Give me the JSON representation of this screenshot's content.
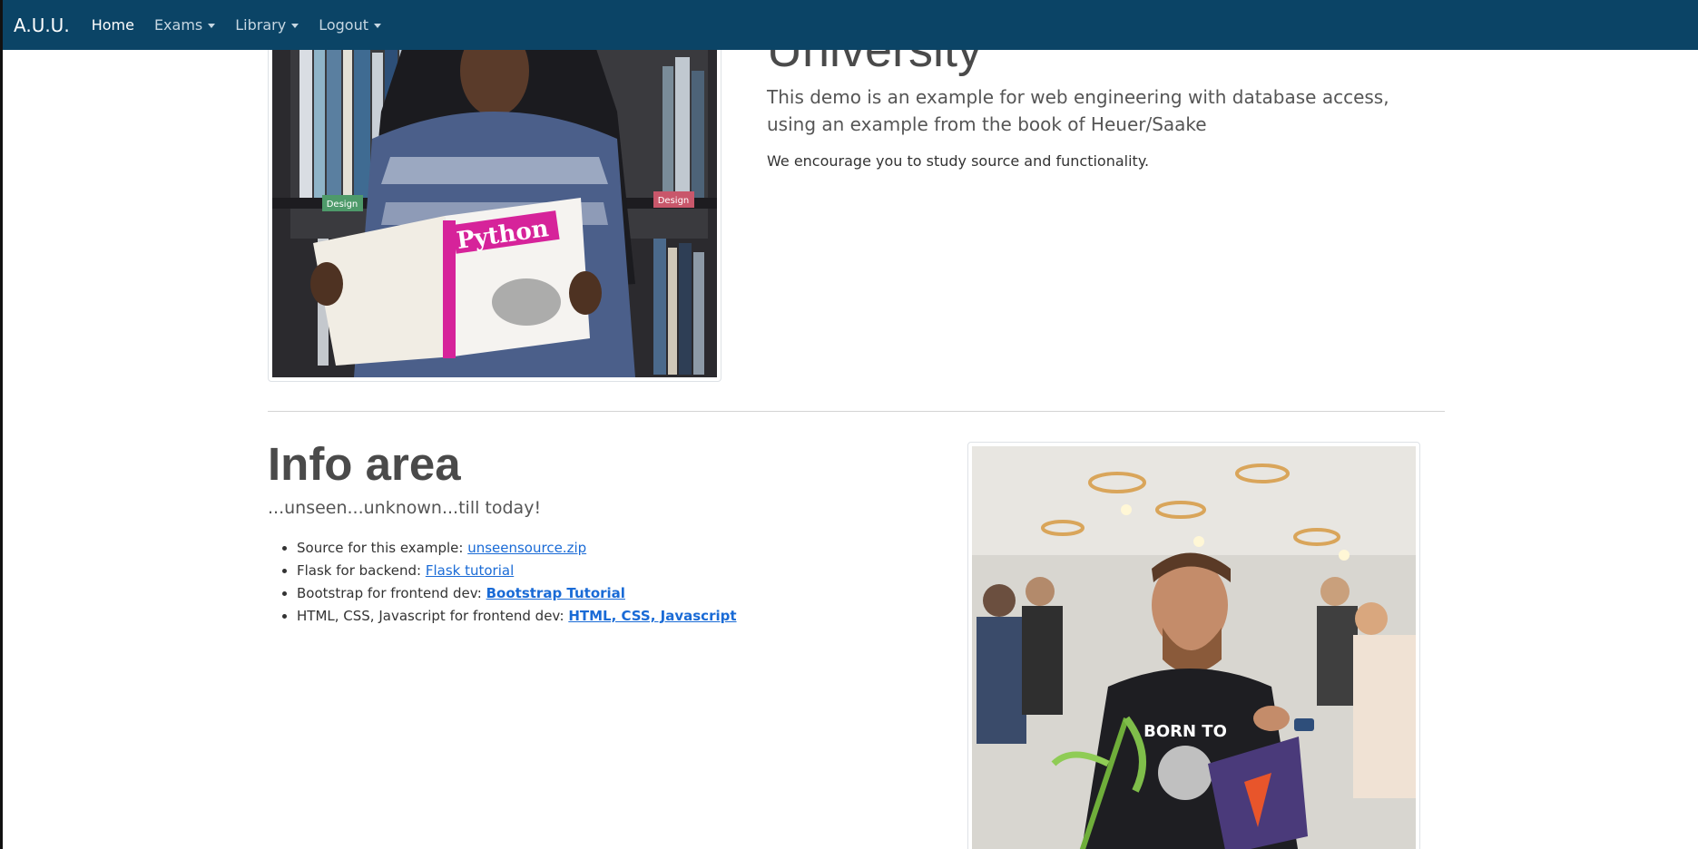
{
  "navbar": {
    "brand": "A.U.U.",
    "items": [
      {
        "label": "Home",
        "active": true,
        "dropdown": false
      },
      {
        "label": "Exams",
        "active": false,
        "dropdown": true
      },
      {
        "label": "Library",
        "active": false,
        "dropdown": true
      },
      {
        "label": "Logout",
        "active": false,
        "dropdown": true
      }
    ],
    "bg_color": "#0b4466"
  },
  "hero": {
    "title": "University",
    "lead": "This demo is an example for web engineering with database access, using an example from the book of Heuer/Saake",
    "text": "We encourage you to study source and functionality."
  },
  "info": {
    "title": "Info area",
    "subtitle": "...unseen...unknown...till today!",
    "items": [
      {
        "text": "Source for this example: ",
        "link": "unseensource.zip",
        "bold": false
      },
      {
        "text": "Flask for backend: ",
        "link": "Flask tutorial",
        "bold": false
      },
      {
        "text": "Bootstrap for frontend dev: ",
        "link": "Bootstrap Tutorial",
        "bold": true
      },
      {
        "text": "HTML, CSS, Javascript for frontend dev: ",
        "link": "HTML, CSS, Javascript",
        "bold": true
      }
    ]
  },
  "images": {
    "book_cover_text": "Python",
    "shelf_label_1": "Design",
    "shelf_label_2": "Design",
    "shirt_text": "BORN TO"
  }
}
